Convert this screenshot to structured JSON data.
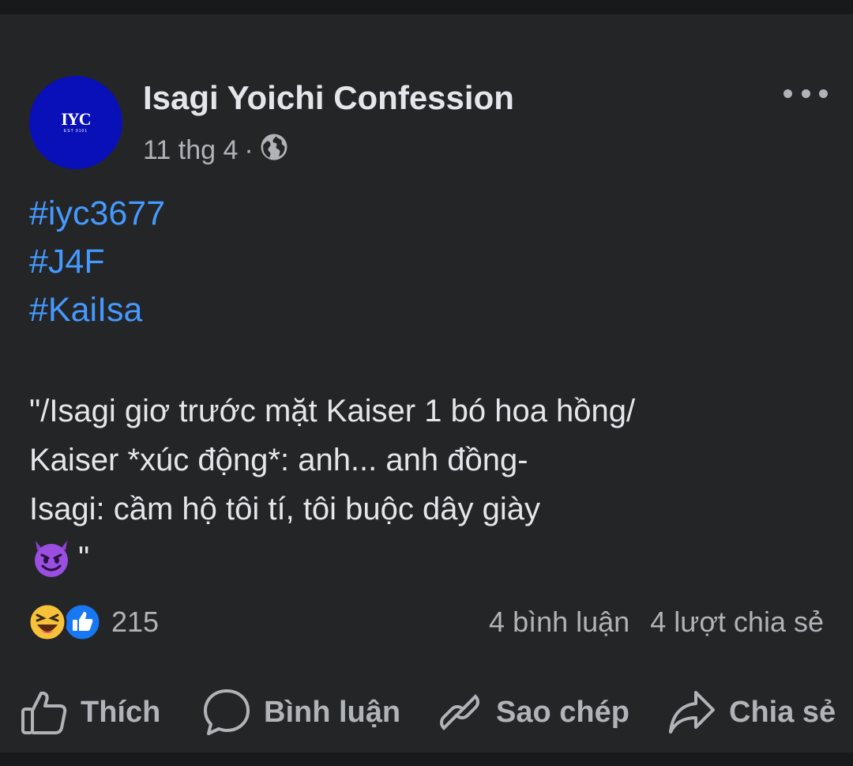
{
  "post": {
    "page_name": "Isagi Yoichi Confession",
    "avatar_text": "IYC",
    "avatar_subtext": "EST 0101",
    "date": "11 thg 4",
    "separator": "·",
    "privacy_icon": "globe-icon",
    "hashtags": [
      "#iyc3677",
      "#J4F",
      "#KaiIsa"
    ],
    "lines": [
      "\"/Isagi giơ trước mặt Kaiser 1 bó hoa hồng/",
      "Kaiser *xúc động*: anh... anh đồng-",
      "Isagi: cầm hộ tôi tí, tôi buộc dây giày",
      "\""
    ],
    "emoji": "smiling-devil-emoji"
  },
  "stats": {
    "reaction_icons": [
      "haha-icon",
      "like-icon"
    ],
    "reaction_count": "215",
    "comments": "4 bình luận",
    "shares": "4 lượt chia sẻ"
  },
  "actions": {
    "like": "Thích",
    "comment": "Bình luận",
    "copy": "Sao chép",
    "share": "Chia sẻ"
  },
  "colors": {
    "background": "#18191a",
    "card": "#242526",
    "hashtag": "#4599ff",
    "avatar": "#0a10b8"
  }
}
